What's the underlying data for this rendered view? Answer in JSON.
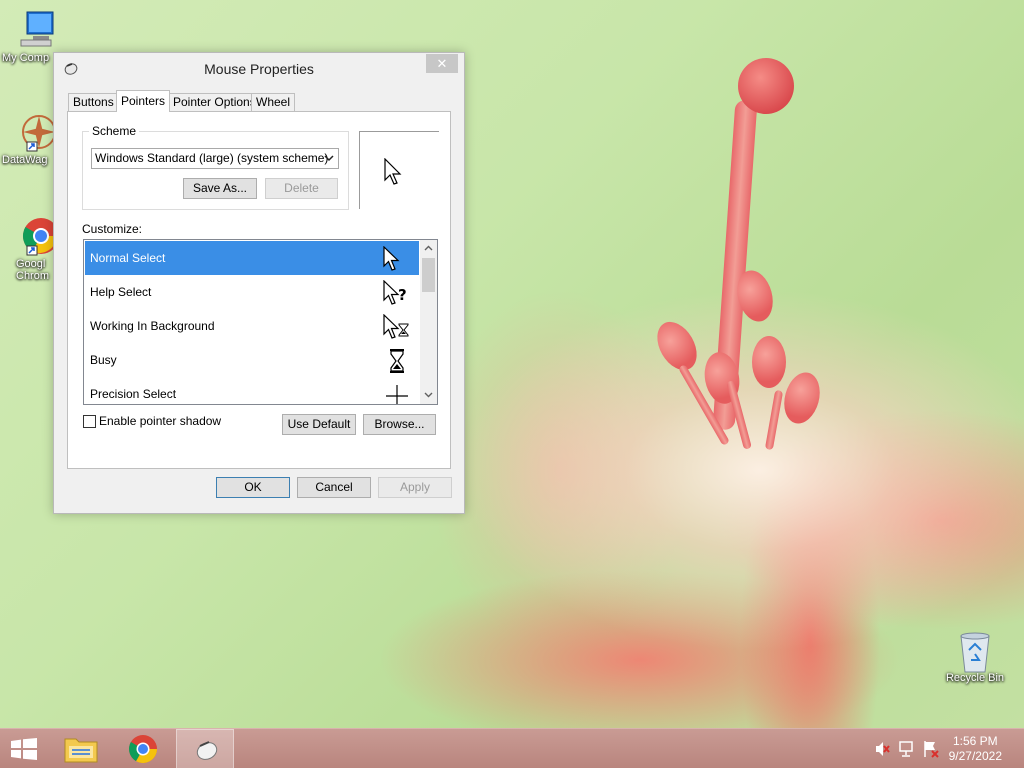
{
  "desktop": {
    "icons": [
      {
        "label": "My Comp"
      },
      {
        "label": "DataWag"
      },
      {
        "label": "Googl Chrom"
      },
      {
        "label": "Recycle Bin"
      }
    ]
  },
  "window": {
    "title": "Mouse Properties",
    "close_symbol": "✕",
    "tabs": [
      {
        "label": "Buttons"
      },
      {
        "label": "Pointers",
        "active": true
      },
      {
        "label": "Pointer Options"
      },
      {
        "label": "Wheel"
      }
    ],
    "scheme": {
      "legend": "Scheme",
      "selected": "Windows Standard (large) (system scheme)",
      "save_as_label": "Save As...",
      "delete_label": "Delete"
    },
    "customize_label": "Customize:",
    "pointer_list": [
      {
        "label": "Normal Select",
        "cursor_icon": "arrow-cursor-icon",
        "selected": true
      },
      {
        "label": "Help Select",
        "cursor_icon": "help-cursor-icon"
      },
      {
        "label": "Working In Background",
        "cursor_icon": "working-cursor-icon"
      },
      {
        "label": "Busy",
        "cursor_icon": "hourglass-cursor-icon"
      },
      {
        "label": "Precision Select",
        "cursor_icon": "crosshair-cursor-icon"
      }
    ],
    "shadow_checkbox_label": "Enable pointer shadow",
    "use_default_label": "Use Default",
    "browse_label": "Browse...",
    "ok_label": "OK",
    "cancel_label": "Cancel",
    "apply_label": "Apply"
  },
  "taskbar": {
    "time": "1:56 PM",
    "date": "9/27/2022"
  },
  "colors": {
    "selection": "#3a8ee6",
    "taskbar": "#c0908a"
  }
}
